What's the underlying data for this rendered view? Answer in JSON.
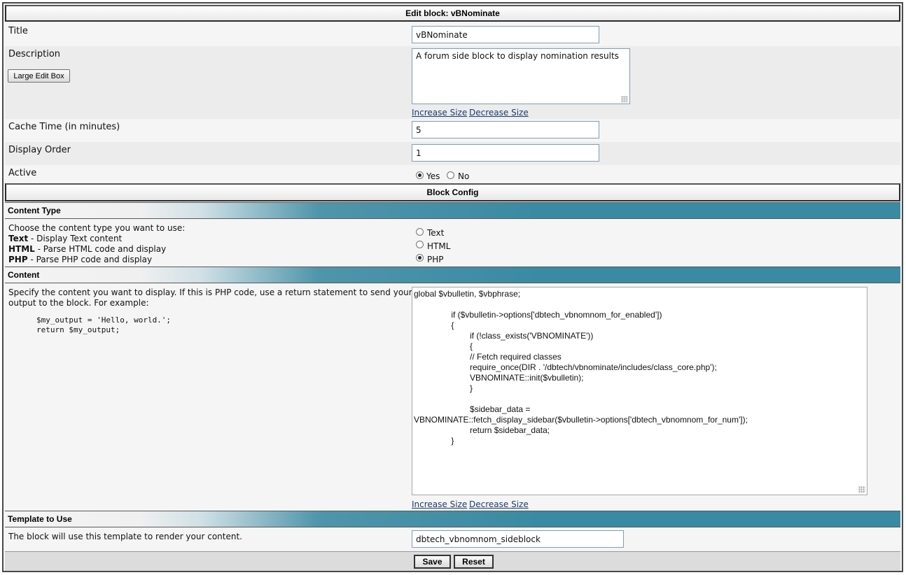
{
  "header": {
    "title": "Edit block: vBNominate"
  },
  "fields": {
    "title": {
      "label": "Title",
      "value": "vBNominate"
    },
    "description": {
      "label": "Description",
      "large_edit_button": "Large Edit Box",
      "value": "A forum side block to display nomination results",
      "increase": "Increase Size",
      "decrease": "Decrease Size"
    },
    "cache_time": {
      "label": "Cache Time (in minutes)",
      "value": "5"
    },
    "display_order": {
      "label": "Display Order",
      "value": "1"
    },
    "active": {
      "label": "Active",
      "yes": "Yes",
      "no": "No",
      "selected": "Yes"
    }
  },
  "block_config": {
    "title": "Block Config"
  },
  "content_type": {
    "heading": "Content Type",
    "intro": "Choose the content type you want to use:",
    "text_key": "Text",
    "text_desc": " - Display Text content",
    "html_key": "HTML",
    "html_desc": " - Parse HTML code and display",
    "php_key": "PHP",
    "php_desc": " - Parse PHP code and display",
    "options": [
      "Text",
      "HTML",
      "PHP"
    ],
    "selected": "PHP"
  },
  "content": {
    "heading": "Content",
    "desc_line1": "Specify the content you want to display. If this is PHP code, use a return statement to send your",
    "desc_line2": "output to the block. For example:",
    "example_line1": "$my_output = 'Hello, world.';",
    "example_line2": "return $my_output;",
    "code": "global $vbulletin, $vbphrase;\n\n                if ($vbulletin->options['dbtech_vbnomnom_for_enabled'])\n                {\n                        if (!class_exists('VBNOMINATE'))\n                        {\n                        // Fetch required classes\n                        require_once(DIR . '/dbtech/vbnominate/includes/class_core.php');\n                        VBNOMINATE::init($vbulletin);\n                        }\n\n                        $sidebar_data =\nVBNOMINATE::fetch_display_sidebar($vbulletin->options['dbtech_vbnomnom_for_num']);\n                        return $sidebar_data;\n                }",
    "increase": "Increase Size",
    "decrease": "Decrease Size"
  },
  "template": {
    "heading": "Template to Use",
    "desc": "The block will use this template to render your content.",
    "value": "dbtech_vbnomnom_sideblock"
  },
  "footer": {
    "save": "Save",
    "reset": "Reset"
  }
}
